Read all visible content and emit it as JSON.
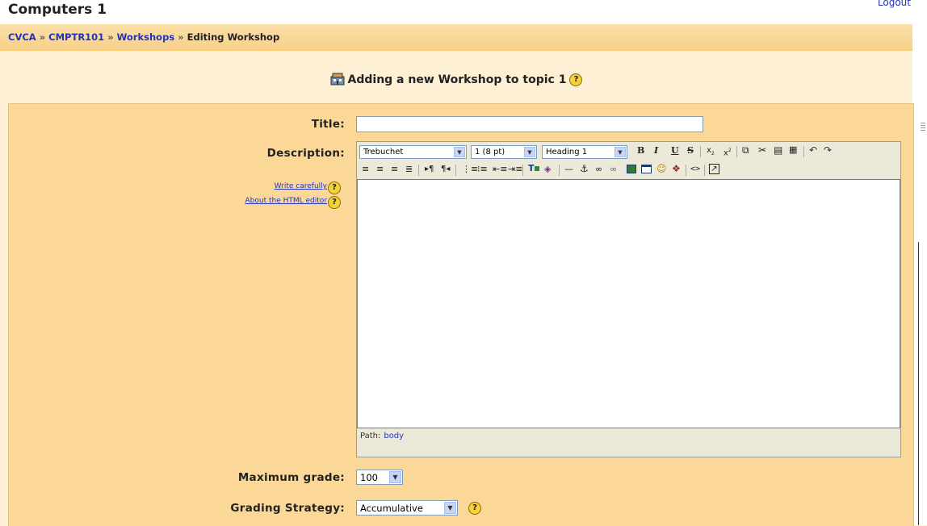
{
  "header": {
    "course_title": "Computers 1",
    "logout_label": "Logout"
  },
  "breadcrumb": {
    "items": [
      "CVCA",
      "CMPTR101",
      "Workshops",
      "Editing Workshop"
    ],
    "separator": "»"
  },
  "page": {
    "heading": "Adding a new Workshop to topic 1",
    "heading_icon": "workshop-icon"
  },
  "form": {
    "title_label": "Title:",
    "title_value": "",
    "description_label": "Description:",
    "write_carefully_link": "Write carefully",
    "about_editor_link": "About the HTML editor",
    "max_grade_label": "Maximum grade:",
    "max_grade_value": "100",
    "grading_strategy_label": "Grading Strategy:",
    "grading_strategy_value": "Accumulative"
  },
  "editor": {
    "font_value": "Trebuchet",
    "size_value": "1 (8 pt)",
    "format_value": "Heading 1",
    "path_label": "Path:",
    "path_value": "body",
    "toolbar1_icons": [
      "bold-icon",
      "italic-icon",
      "underline-icon",
      "strikethrough-icon",
      "subscript-icon",
      "superscript-icon",
      "copy-icon",
      "cut-icon",
      "paste-icon",
      "clean-word-icon",
      "undo-icon",
      "redo-icon"
    ],
    "toolbar2_icons": [
      "align-left-icon",
      "align-center-icon",
      "align-right-icon",
      "justify-icon",
      "ltr-icon",
      "rtl-icon",
      "ordered-list-icon",
      "unordered-list-icon",
      "outdent-icon",
      "indent-icon",
      "text-color-icon",
      "background-color-icon",
      "horizontal-rule-icon",
      "anchor-icon",
      "link-icon",
      "unlink-icon",
      "image-icon",
      "table-icon",
      "smiley-icon",
      "special-char-icon",
      "html-source-icon",
      "fullscreen-icon"
    ]
  },
  "colors": {
    "link": "#2233bb",
    "form_background": "#fbd898",
    "page_background": "#fdf0d4",
    "help_icon": "#f7d13a"
  }
}
